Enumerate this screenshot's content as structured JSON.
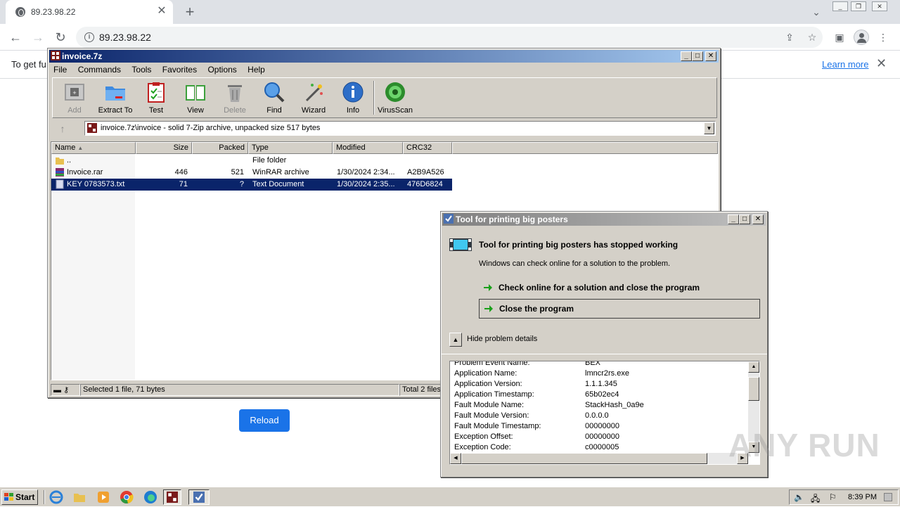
{
  "browser": {
    "tab_title": "89.23.98.22",
    "url": "89.23.98.22",
    "infobar_text": "To get fu",
    "learn_more": "Learn more",
    "reload_label": "Reload"
  },
  "sevenzip": {
    "title": "invoice.7z",
    "menu": [
      "File",
      "Commands",
      "Tools",
      "Favorites",
      "Options",
      "Help"
    ],
    "toolbar": [
      "Add",
      "Extract To",
      "Test",
      "View",
      "Delete",
      "Find",
      "Wizard",
      "Info",
      "VirusScan"
    ],
    "address": "invoice.7z\\invoice - solid 7-Zip archive, unpacked size 517 bytes",
    "columns": [
      "Name",
      "Size",
      "Packed",
      "Type",
      "Modified",
      "CRC32"
    ],
    "rows": [
      {
        "name": "..",
        "size": "",
        "packed": "",
        "type": "File folder",
        "modified": "",
        "crc": ""
      },
      {
        "name": "Invoice.rar",
        "size": "446",
        "packed": "521",
        "type": "WinRAR archive",
        "modified": "1/30/2024 2:34...",
        "crc": "A2B9A526"
      },
      {
        "name": "KEY 0783573.txt",
        "size": "71",
        "packed": "?",
        "type": "Text Document",
        "modified": "1/30/2024 2:35...",
        "crc": "476D6824"
      }
    ],
    "status_selected": "Selected 1 file, 71 bytes",
    "status_total": "Total 2 files"
  },
  "dialog": {
    "title": "Tool for printing big posters",
    "heading": "Tool for printing big posters has stopped working",
    "subtext": "Windows can check online for a solution to the problem.",
    "option_check": "Check online for a solution and close the program",
    "option_close": "Close the program",
    "details_toggle": "Hide problem details",
    "details": [
      {
        "k": "Problem Event Name:",
        "v": "BEX"
      },
      {
        "k": "Application Name:",
        "v": "lmncr2rs.exe"
      },
      {
        "k": "Application Version:",
        "v": "1.1.1.345"
      },
      {
        "k": "Application Timestamp:",
        "v": "65b02ec4"
      },
      {
        "k": "Fault Module Name:",
        "v": "StackHash_0a9e"
      },
      {
        "k": "Fault Module Version:",
        "v": "0.0.0.0"
      },
      {
        "k": "Fault Module Timestamp:",
        "v": "00000000"
      },
      {
        "k": "Exception Offset:",
        "v": "00000000"
      },
      {
        "k": "Exception Code:",
        "v": "c0000005"
      }
    ]
  },
  "taskbar": {
    "start": "Start",
    "clock": "8:39 PM"
  },
  "watermark": "ANY RUN",
  "colors": {
    "titlebar_active": "#0a246a",
    "selection": "#0a246a",
    "chrome_accent": "#1a73e8",
    "win_face": "#d4d0c8"
  }
}
